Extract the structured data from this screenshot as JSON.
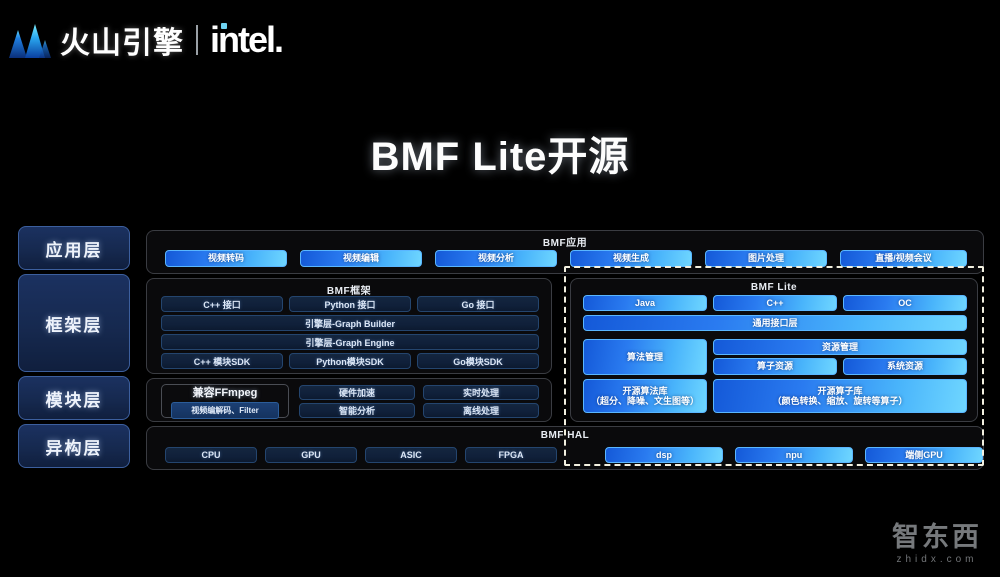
{
  "brand": {
    "logo_icon": "volcano-engine-mountain-icon",
    "cn_name": "火山引擎",
    "partner": "intel",
    "partner_suffix": "."
  },
  "slide": {
    "title": "BMF Lite开源"
  },
  "layers": [
    {
      "label": "应用层"
    },
    {
      "label": "框架层"
    },
    {
      "label": "模块层"
    },
    {
      "label": "异构层"
    }
  ],
  "diagram": {
    "app_panel": {
      "title": "BMF应用",
      "items": [
        "视频转码",
        "视频编辑",
        "视频分析",
        "视频生成",
        "图片处理",
        "直播/视频会议"
      ]
    },
    "framework_panel": {
      "title": "BMF框架",
      "interfaces": [
        "C++ 接口",
        "Python 接口",
        "Go 接口"
      ],
      "engines": [
        "引擎层-Graph Builder",
        "引擎层-Graph Engine"
      ],
      "sdks": [
        "C++ 模块SDK",
        "Python模块SDK",
        "Go模块SDK"
      ]
    },
    "module_panel": {
      "ffmpeg_title": "兼容FFmpeg",
      "ffmpeg_sub": "视频编解码、Filter",
      "items": [
        "硬件加速",
        "实时处理",
        "智能分析",
        "离线处理"
      ]
    },
    "lite_panel": {
      "title": "BMF Lite",
      "languages": [
        "Java",
        "C++",
        "OC"
      ],
      "common_api": "通用接口层",
      "algo_manage": "算法管理",
      "resource_manage": "资源管理",
      "resource_children": [
        "算子资源",
        "系统资源"
      ],
      "algo_lib_title": "开源算法库",
      "algo_lib_sub": "（超分、降噪、文生图等）",
      "op_lib_title": "开源算子库",
      "op_lib_sub": "（颜色转换、缩放、旋转等算子）"
    },
    "hal_panel": {
      "title": "BMF HAL",
      "left_items": [
        "CPU",
        "GPU",
        "ASIC",
        "FPGA"
      ],
      "right_items": [
        "dsp",
        "npu",
        "端侧GPU"
      ]
    }
  },
  "watermark": {
    "cn": "智东西",
    "en": "zhidx.com"
  },
  "colors": {
    "background": "#000000",
    "accent_blue": "#2a7bf0",
    "accent_cyan": "#6fd6ff",
    "layer_chip": "#16294f",
    "dashed_border": "#f2f0e0"
  }
}
